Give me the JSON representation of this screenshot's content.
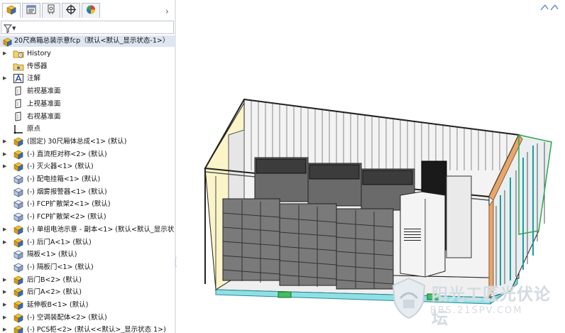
{
  "feature_tree": {
    "tabs": [
      {
        "name": "feature-manager-tab-icon",
        "active": true
      },
      {
        "name": "property-manager-tab-icon",
        "active": false
      },
      {
        "name": "configuration-manager-tab-icon",
        "active": false
      },
      {
        "name": "dimxpert-manager-tab-icon",
        "active": false
      },
      {
        "name": "display-manager-tab-icon",
        "active": false
      }
    ],
    "more_glyph": "›",
    "filter_icon": "funnel-icon",
    "root_label": "20尺高箱总装示意fcp（默认<默认_显示状态-1>）",
    "items": [
      {
        "label": "History",
        "icon": "history-folder-icon",
        "expand": "▶"
      },
      {
        "label": "传感器",
        "icon": "sensors-icon",
        "expand": ""
      },
      {
        "label": "注解",
        "icon": "annotations-icon",
        "expand": "▶"
      },
      {
        "label": "前视基准面",
        "icon": "plane-icon",
        "expand": ""
      },
      {
        "label": "上视基准面",
        "icon": "plane-icon",
        "expand": ""
      },
      {
        "label": "右视基准面",
        "icon": "plane-icon",
        "expand": ""
      },
      {
        "label": "原点",
        "icon": "origin-icon",
        "expand": ""
      },
      {
        "label": "(固定) 30尺厢体总成<1> (默认)",
        "icon": "subassembly-icon",
        "expand": "▶"
      },
      {
        "label": "(-) 直流柜对称<2> (默认)",
        "icon": "subassembly-icon",
        "expand": "▶"
      },
      {
        "label": "(-) 灭火器<1> (默认)",
        "icon": "subassembly-icon",
        "expand": "▶"
      },
      {
        "label": "(-) 配电挂箱<1> (默认)",
        "icon": "part-icon",
        "expand": ""
      },
      {
        "label": "(-) 烟雾报警器<1> (默认)",
        "icon": "part-icon",
        "expand": ""
      },
      {
        "label": "(-) FCP扩散架2<1> (默认)",
        "icon": "part-icon",
        "expand": ""
      },
      {
        "label": "(-) FCP扩散架<2> (默认)",
        "icon": "part-icon",
        "expand": ""
      },
      {
        "label": "(-) 单组电池示意 - 副本<1> (默认<默认_显示状",
        "icon": "subassembly-icon",
        "expand": "▶"
      },
      {
        "label": "(-) 后门A<1> (默认)",
        "icon": "subassembly-icon",
        "expand": "▶"
      },
      {
        "label": "隔板<1> (默认)",
        "icon": "part-icon",
        "expand": ""
      },
      {
        "label": "(-) 隔板门<1> (默认)",
        "icon": "part-icon",
        "expand": ""
      },
      {
        "label": "后门B<2> (默认)",
        "icon": "subassembly-icon",
        "expand": "▶"
      },
      {
        "label": "后门A<2> (默认)",
        "icon": "subassembly-icon",
        "expand": "▶"
      },
      {
        "label": "延伸板B<1> (默认)",
        "icon": "subassembly-icon",
        "expand": "▶"
      },
      {
        "label": "(-) 空调装配体<2> (默认)",
        "icon": "subassembly-icon",
        "expand": "▶"
      },
      {
        "label": "(-) PCS柜<2> (默认<<默认>_显示状态 1>)",
        "icon": "subassembly-icon",
        "expand": "▶"
      }
    ]
  },
  "viewport": {
    "model": "20ft container assembly (shaded isometric view)",
    "corner_icon": "reference-triad-icon",
    "watermark": {
      "text": "阳光工匠光伏论坛",
      "url": "BBS.21SPV.COM",
      "logo": "shield-logo"
    }
  },
  "colors": {
    "selection": "#dfe6f2",
    "assembly_yellow": "#f2c230",
    "assembly_blue": "#3b6db6",
    "frame_teal": "#46c7c9",
    "door_orange": "#e6a76c",
    "battery_dark": "#3c3c3c"
  }
}
